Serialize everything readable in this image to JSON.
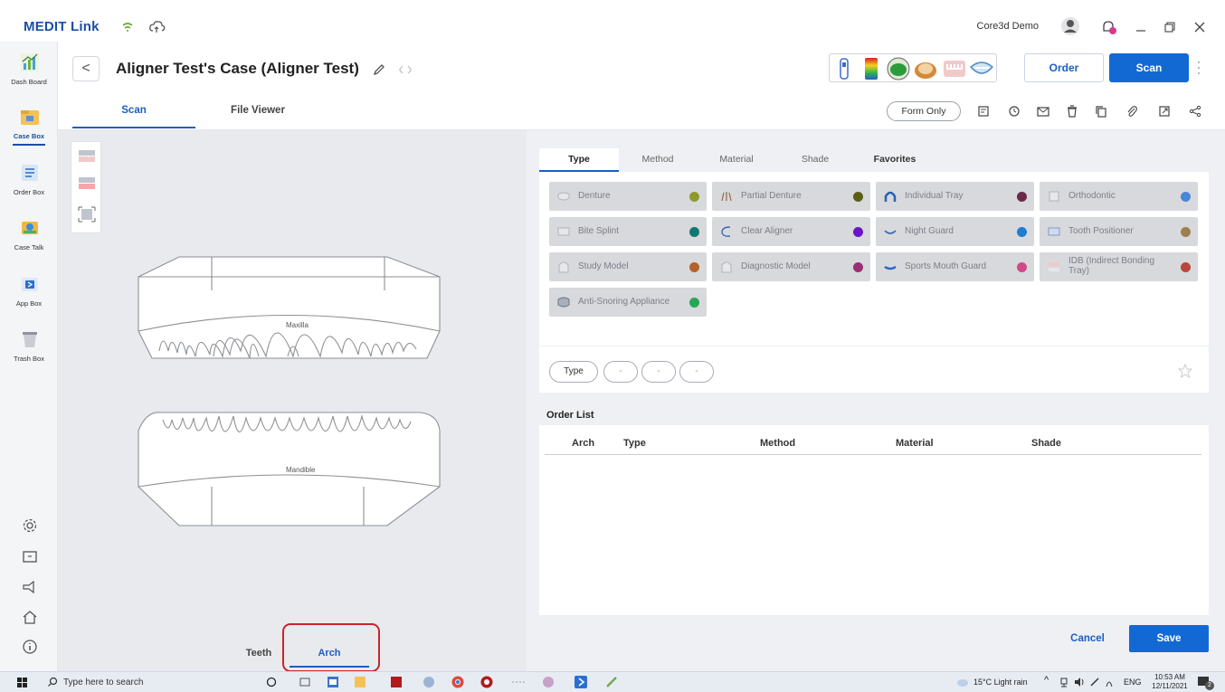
{
  "app": {
    "logo": "MEDIT Link",
    "user": "Core3d Demo"
  },
  "nav": {
    "items": [
      {
        "label": "Dash Board"
      },
      {
        "label": "Case Box"
      },
      {
        "label": "Order Box"
      },
      {
        "label": "Case Talk"
      },
      {
        "label": "App Box"
      },
      {
        "label": "Trash Box"
      }
    ]
  },
  "header": {
    "back_glyph": "<",
    "title": "Aligner Test's Case (Aligner Test)",
    "tabs": [
      "Scan",
      "File Viewer"
    ],
    "order_label": "Order",
    "scan_label": "Scan",
    "form_only": "Form Only"
  },
  "canvas": {
    "maxilla": "Maxilla",
    "mandible": "Mandible",
    "bottom_tabs": [
      "Teeth",
      "Arch"
    ]
  },
  "panel": {
    "tabs": [
      "Type",
      "Method",
      "Material",
      "Shade",
      "Favorites"
    ],
    "types": [
      {
        "label": "Denture",
        "color": "#8e9a2b"
      },
      {
        "label": "Partial Denture",
        "color": "#5b5f12"
      },
      {
        "label": "Individual Tray",
        "color": "#6a2a4a"
      },
      {
        "label": "Orthodontic",
        "color": "#4c86d6"
      },
      {
        "label": "Bite Splint",
        "color": "#11776f"
      },
      {
        "label": "Clear Aligner",
        "color": "#6a16c8"
      },
      {
        "label": "Night Guard",
        "color": "#1f7dd0"
      },
      {
        "label": "Tooth Positioner",
        "color": "#9e7e4c"
      },
      {
        "label": "Study Model",
        "color": "#b4622a"
      },
      {
        "label": "Diagnostic Model",
        "color": "#9a2f72"
      },
      {
        "label": "Sports Mouth Guard",
        "color": "#d14a88"
      },
      {
        "label": "IDB (Indirect Bonding Tray)",
        "color": "#b8463a"
      },
      {
        "label": "Anti-Snoring Appliance",
        "color": "#27a65a"
      }
    ],
    "filters": [
      "Type",
      "-",
      "-",
      "-"
    ],
    "order_list_title": "Order List",
    "order_columns": [
      "Arch",
      "Type",
      "Method",
      "Material",
      "Shade"
    ],
    "cancel_label": "Cancel",
    "save_label": "Save"
  },
  "taskbar": {
    "search_placeholder": "Type here to search",
    "weather": "15°C  Light rain",
    "lang": "ENG",
    "time": "10:53 AM",
    "date": "12/11/2021",
    "notif_count": "2"
  },
  "colors": {
    "brand_blue": "#1369d4",
    "highlight_red": "#c8232c"
  }
}
